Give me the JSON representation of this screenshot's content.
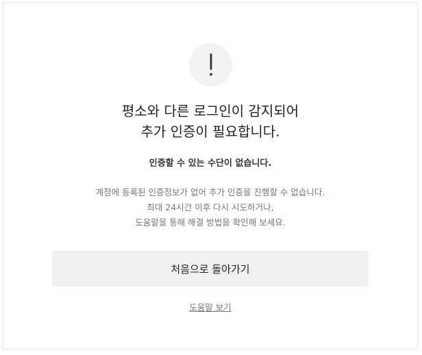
{
  "alert": {
    "icon": "exclamation-icon",
    "circle_color": "#f2f2f2",
    "icon_color": "#333333"
  },
  "title": {
    "line1": "평소와 다른 로그인이 감지되어",
    "line2": "추가 인증이 필요합니다."
  },
  "subtitle": "인증할 수 있는 수단이 없습니다.",
  "description": {
    "line1": "계정에 등록된 인증정보가 없어 추가 인증을 진행할 수 없습니다.",
    "line2": "최대 24시간 이후 다시 시도하거나,",
    "line3": "도움말을 통해 해결 방법을 확인해 보세요."
  },
  "actions": {
    "home_button_label": "처음으로 돌아가기",
    "help_link_label": "도움말 보기"
  }
}
